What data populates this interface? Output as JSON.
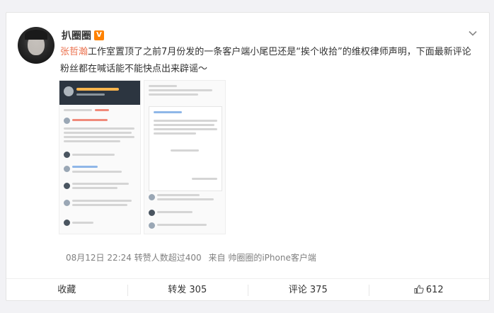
{
  "post": {
    "username": "扒圈圈",
    "vip_badge": "V",
    "mention": "张哲瀚",
    "text_rest": "工作室置顶了之前7月份发的一条客户端小尾巴还是“挨个收拾”的维权律师声明，下面最新评论粉丝都在喊话能不能快点出来辟谣～",
    "date": "08月12日 22:24",
    "repost_info": "转赞人数超过400",
    "source": "来自 帅圈圈的iPhone客户端"
  },
  "actions": {
    "favorite": "收藏",
    "repost": "转发 305",
    "comment": "评论 375",
    "like": "612"
  },
  "colors": {
    "mention": "#eb7350",
    "vip": "#ff8200"
  }
}
